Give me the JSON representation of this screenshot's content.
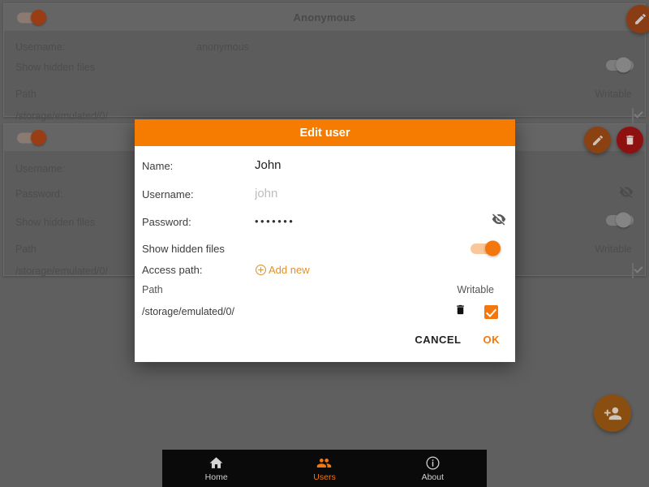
{
  "app": {
    "accent": "#f4770d",
    "dialog_header_bg": "#f57c00",
    "danger": "#8e1010"
  },
  "cards": [
    {
      "title": "Anonymous",
      "enabled_toggle": "on",
      "fields": [
        {
          "label": "Username:",
          "value": "anonymous"
        }
      ],
      "show_hidden_files_label": "Show hidden files",
      "show_hidden_files_state": "off",
      "path_header": "Path",
      "writable_header": "Writable",
      "path_value": "/storage/emulated/0/",
      "writable_checked": true,
      "edit_icon": "pencil-icon"
    },
    {
      "title": "",
      "enabled_toggle": "on",
      "fields": [
        {
          "label": "Username:",
          "value": ""
        },
        {
          "label": "Password:",
          "value": ""
        }
      ],
      "show_hidden_files_label": "Show hidden files",
      "show_hidden_files_state": "off",
      "path_header": "Path",
      "writable_header": "Writable",
      "path_value": "/storage/emulated/0/",
      "writable_checked": true,
      "edit_icon": "pencil-icon",
      "delete_icon": "trash-icon"
    }
  ],
  "dialog": {
    "title": "Edit user",
    "fields": {
      "name": {
        "label": "Name:",
        "value": "John",
        "placeholder": "",
        "focused": true
      },
      "username": {
        "label": "Username:",
        "value": "",
        "placeholder": "john",
        "focused": false
      },
      "password": {
        "label": "Password:",
        "value": "•••••••",
        "placeholder": "",
        "focused": false,
        "reveal_icon": "eye-off-icon"
      }
    },
    "show_hidden_files": {
      "label": "Show hidden files",
      "state": "on"
    },
    "access_path": {
      "label": "Access path:",
      "add_new_label": "Add new",
      "add_icon": "plus-circle-icon"
    },
    "path_table": {
      "headers": {
        "path": "Path",
        "writable": "Writable"
      },
      "rows": [
        {
          "path": "/storage/emulated/0/",
          "delete_icon": "trash-icon",
          "writable": true
        }
      ]
    },
    "buttons": {
      "cancel": "CANCEL",
      "ok": "OK"
    }
  },
  "fab": {
    "icon": "person-add-icon",
    "label": ""
  },
  "bottom_nav": {
    "items": [
      {
        "label": "Home",
        "icon": "home-icon",
        "active": false
      },
      {
        "label": "Users",
        "icon": "people-icon",
        "active": true
      },
      {
        "label": "About",
        "icon": "info-icon",
        "active": false
      }
    ]
  }
}
